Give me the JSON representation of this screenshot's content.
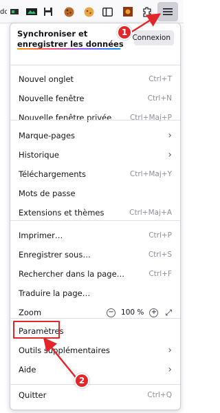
{
  "toolbar": {
    "left_partial_text": "dde",
    "icons": [
      "extension-icon",
      "screenshot-icon",
      "save-icon",
      "cookie-icon",
      "cookie-icon",
      "sidebar-icon",
      "addon-icon",
      "pin-icon",
      "extensions-icon"
    ],
    "menu_icon": "hamburger-menu-icon"
  },
  "menu": {
    "sync": {
      "title": "Synchroniser et enregistrer les données",
      "connect_label": "Connexion"
    },
    "items": [
      {
        "label": "Nouvel onglet",
        "shortcut": "Ctrl+T"
      },
      {
        "label": "Nouvelle fenêtre",
        "shortcut": "Ctrl+N"
      },
      {
        "label": "Nouvelle fenêtre privée",
        "shortcut": "Ctrl+Maj+P"
      },
      {
        "label": "Marque-pages",
        "shortcut": ""
      },
      {
        "label": "Historique",
        "shortcut": ""
      },
      {
        "label": "Téléchargements",
        "shortcut": "Ctrl+Maj+Y"
      },
      {
        "label": "Mots de passe",
        "shortcut": ""
      },
      {
        "label": "Extensions et thèmes",
        "shortcut": "Ctrl+Maj+A"
      },
      {
        "label": "Imprimer…",
        "shortcut": "Ctrl+P"
      },
      {
        "label": "Enregistrer sous…",
        "shortcut": "Ctrl+S"
      },
      {
        "label": "Rechercher dans la page…",
        "shortcut": "Ctrl+F"
      },
      {
        "label": "Traduire la page…",
        "shortcut": ""
      },
      {
        "label": "Zoom",
        "shortcut": ""
      },
      {
        "label": "Paramètres",
        "shortcut": ""
      },
      {
        "label": "Outils supplémentaires",
        "shortcut": ""
      },
      {
        "label": "Aide",
        "shortcut": ""
      },
      {
        "label": "Quitter",
        "shortcut": "Ctrl+Q"
      }
    ],
    "zoom": {
      "minus": "−",
      "value": "100 %",
      "plus": "+"
    }
  },
  "annotations": {
    "step1": "1",
    "step2": "2",
    "color": "#e3262a"
  }
}
